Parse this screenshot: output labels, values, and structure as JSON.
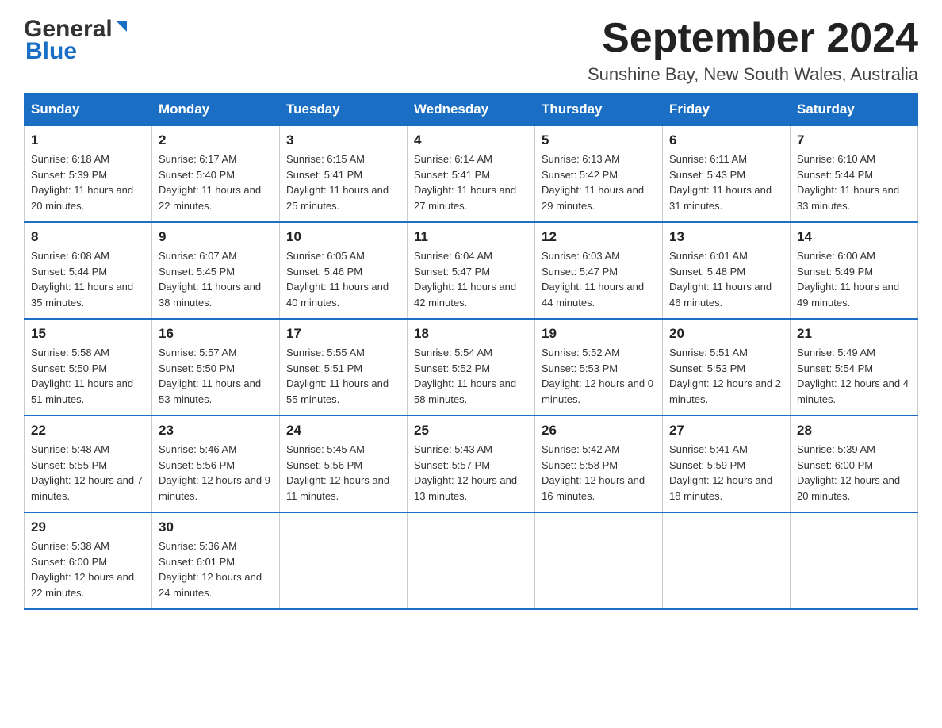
{
  "header": {
    "logo_general": "General",
    "logo_blue": "Blue",
    "month_title": "September 2024",
    "location": "Sunshine Bay, New South Wales, Australia"
  },
  "days_of_week": [
    "Sunday",
    "Monday",
    "Tuesday",
    "Wednesday",
    "Thursday",
    "Friday",
    "Saturday"
  ],
  "weeks": [
    [
      {
        "day": "1",
        "sunrise": "6:18 AM",
        "sunset": "5:39 PM",
        "daylight": "11 hours and 20 minutes."
      },
      {
        "day": "2",
        "sunrise": "6:17 AM",
        "sunset": "5:40 PM",
        "daylight": "11 hours and 22 minutes."
      },
      {
        "day": "3",
        "sunrise": "6:15 AM",
        "sunset": "5:41 PM",
        "daylight": "11 hours and 25 minutes."
      },
      {
        "day": "4",
        "sunrise": "6:14 AM",
        "sunset": "5:41 PM",
        "daylight": "11 hours and 27 minutes."
      },
      {
        "day": "5",
        "sunrise": "6:13 AM",
        "sunset": "5:42 PM",
        "daylight": "11 hours and 29 minutes."
      },
      {
        "day": "6",
        "sunrise": "6:11 AM",
        "sunset": "5:43 PM",
        "daylight": "11 hours and 31 minutes."
      },
      {
        "day": "7",
        "sunrise": "6:10 AM",
        "sunset": "5:44 PM",
        "daylight": "11 hours and 33 minutes."
      }
    ],
    [
      {
        "day": "8",
        "sunrise": "6:08 AM",
        "sunset": "5:44 PM",
        "daylight": "11 hours and 35 minutes."
      },
      {
        "day": "9",
        "sunrise": "6:07 AM",
        "sunset": "5:45 PM",
        "daylight": "11 hours and 38 minutes."
      },
      {
        "day": "10",
        "sunrise": "6:05 AM",
        "sunset": "5:46 PM",
        "daylight": "11 hours and 40 minutes."
      },
      {
        "day": "11",
        "sunrise": "6:04 AM",
        "sunset": "5:47 PM",
        "daylight": "11 hours and 42 minutes."
      },
      {
        "day": "12",
        "sunrise": "6:03 AM",
        "sunset": "5:47 PM",
        "daylight": "11 hours and 44 minutes."
      },
      {
        "day": "13",
        "sunrise": "6:01 AM",
        "sunset": "5:48 PM",
        "daylight": "11 hours and 46 minutes."
      },
      {
        "day": "14",
        "sunrise": "6:00 AM",
        "sunset": "5:49 PM",
        "daylight": "11 hours and 49 minutes."
      }
    ],
    [
      {
        "day": "15",
        "sunrise": "5:58 AM",
        "sunset": "5:50 PM",
        "daylight": "11 hours and 51 minutes."
      },
      {
        "day": "16",
        "sunrise": "5:57 AM",
        "sunset": "5:50 PM",
        "daylight": "11 hours and 53 minutes."
      },
      {
        "day": "17",
        "sunrise": "5:55 AM",
        "sunset": "5:51 PM",
        "daylight": "11 hours and 55 minutes."
      },
      {
        "day": "18",
        "sunrise": "5:54 AM",
        "sunset": "5:52 PM",
        "daylight": "11 hours and 58 minutes."
      },
      {
        "day": "19",
        "sunrise": "5:52 AM",
        "sunset": "5:53 PM",
        "daylight": "12 hours and 0 minutes."
      },
      {
        "day": "20",
        "sunrise": "5:51 AM",
        "sunset": "5:53 PM",
        "daylight": "12 hours and 2 minutes."
      },
      {
        "day": "21",
        "sunrise": "5:49 AM",
        "sunset": "5:54 PM",
        "daylight": "12 hours and 4 minutes."
      }
    ],
    [
      {
        "day": "22",
        "sunrise": "5:48 AM",
        "sunset": "5:55 PM",
        "daylight": "12 hours and 7 minutes."
      },
      {
        "day": "23",
        "sunrise": "5:46 AM",
        "sunset": "5:56 PM",
        "daylight": "12 hours and 9 minutes."
      },
      {
        "day": "24",
        "sunrise": "5:45 AM",
        "sunset": "5:56 PM",
        "daylight": "12 hours and 11 minutes."
      },
      {
        "day": "25",
        "sunrise": "5:43 AM",
        "sunset": "5:57 PM",
        "daylight": "12 hours and 13 minutes."
      },
      {
        "day": "26",
        "sunrise": "5:42 AM",
        "sunset": "5:58 PM",
        "daylight": "12 hours and 16 minutes."
      },
      {
        "day": "27",
        "sunrise": "5:41 AM",
        "sunset": "5:59 PM",
        "daylight": "12 hours and 18 minutes."
      },
      {
        "day": "28",
        "sunrise": "5:39 AM",
        "sunset": "6:00 PM",
        "daylight": "12 hours and 20 minutes."
      }
    ],
    [
      {
        "day": "29",
        "sunrise": "5:38 AM",
        "sunset": "6:00 PM",
        "daylight": "12 hours and 22 minutes."
      },
      {
        "day": "30",
        "sunrise": "5:36 AM",
        "sunset": "6:01 PM",
        "daylight": "12 hours and 24 minutes."
      },
      null,
      null,
      null,
      null,
      null
    ]
  ],
  "labels": {
    "sunrise": "Sunrise:",
    "sunset": "Sunset:",
    "daylight": "Daylight:"
  }
}
